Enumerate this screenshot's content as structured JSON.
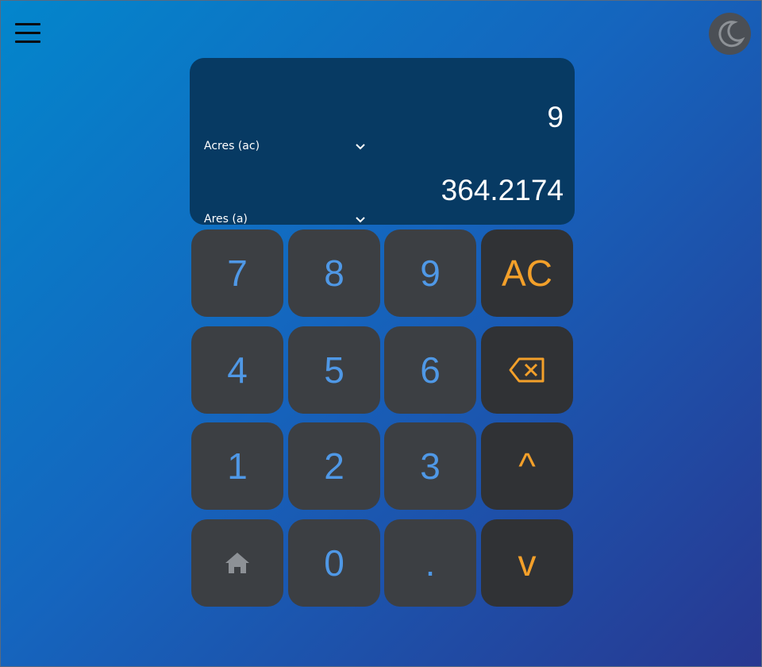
{
  "header": {
    "menu_icon": "hamburger-menu-icon",
    "theme_icon": "moon-icon"
  },
  "display": {
    "from_unit": "Acres (ac)",
    "to_unit": "Ares (a)",
    "input_value": "9",
    "output_value": "364.2174"
  },
  "keypad": {
    "keys": {
      "k7": "7",
      "k8": "8",
      "k9": "9",
      "ac": "AC",
      "k4": "4",
      "k5": "5",
      "k6": "6",
      "backspace": "⌫",
      "k1": "1",
      "k2": "2",
      "k3": "3",
      "up": "^",
      "home": "",
      "k0": "0",
      "dot": ".",
      "down": "v"
    },
    "icons": {
      "backspace": "backspace-icon",
      "home": "home-icon",
      "up": "caret-up-icon",
      "down": "caret-down-icon"
    }
  },
  "colors": {
    "background_start": "#0386cc",
    "background_end": "#283891",
    "display_bg": "#073a63",
    "key_bg": "#3c3f43",
    "op_key_bg": "#303235",
    "digit_color": "#4f98e6",
    "op_color": "#f3a02a"
  }
}
